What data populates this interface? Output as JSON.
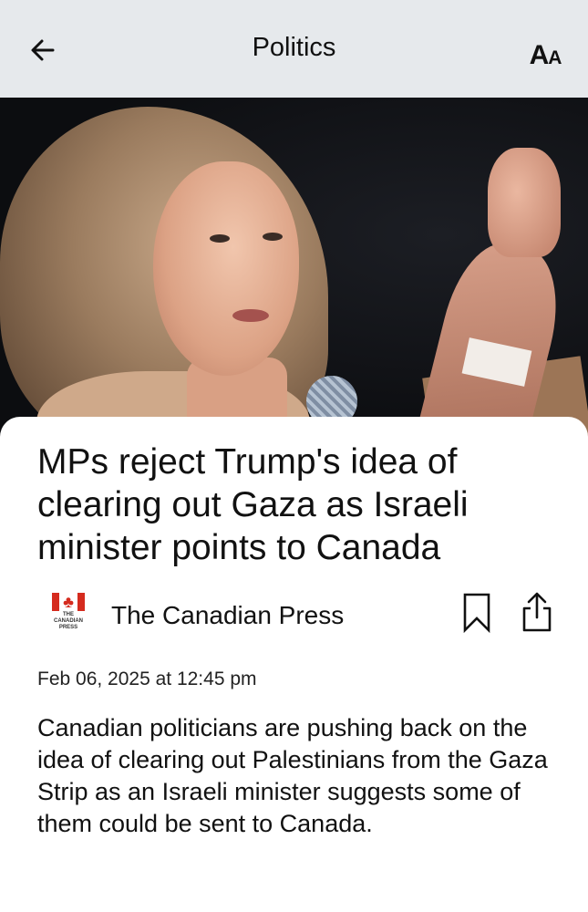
{
  "header": {
    "title": "Politics",
    "font_size_big": "A",
    "font_size_small": "A",
    "back_icon": "arrow-left-icon"
  },
  "article": {
    "headline": "MPs reject Trump's idea of clearing out Gaza as Israeli minister points to Canada",
    "source": {
      "name": "The Canadian Press",
      "logo_text_1": "THE",
      "logo_text_2": "CANADIAN",
      "logo_text_3": "PRESS",
      "logo_color": "#d52b1e"
    },
    "date": "Feb 06, 2025 at 12:45 pm",
    "summary": "Canadian politicians are pushing back on the idea of clearing out Palestinians from the Gaza Strip as an Israeli minister suggests some of them could be sent to Canada."
  },
  "icons": {
    "bookmark": "bookmark-icon",
    "share": "share-icon"
  }
}
